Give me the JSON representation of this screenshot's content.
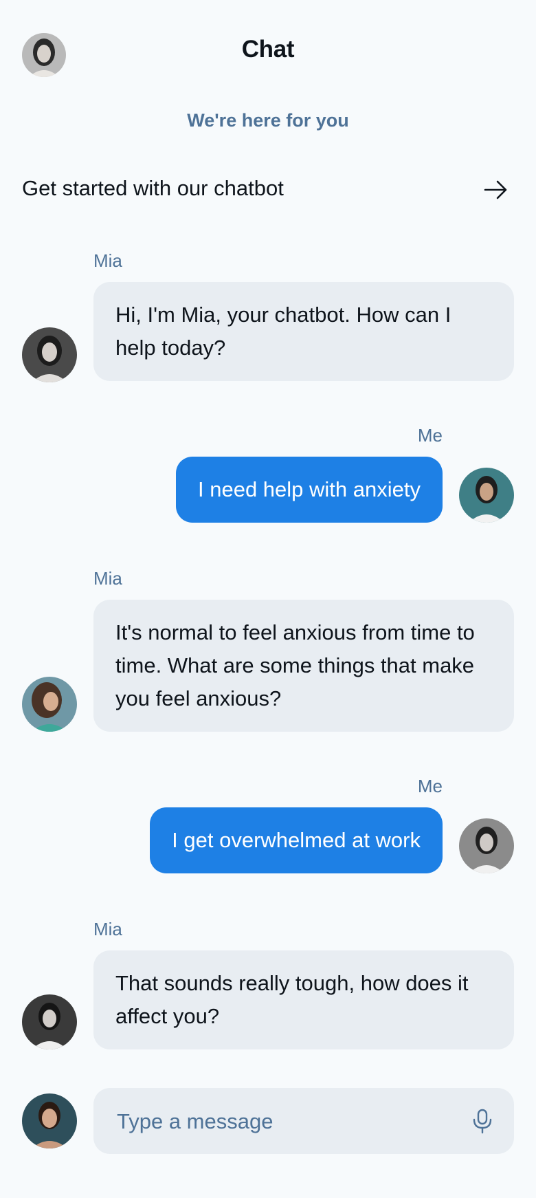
{
  "header": {
    "title": "Chat",
    "avatar_icon": "user-avatar-photo"
  },
  "subtitle": "We're here for you",
  "cta": {
    "label": "Get started with our chatbot",
    "icon": "arrow-right-icon"
  },
  "messages": [
    {
      "sender": "Mia",
      "from": "bot",
      "text": "Hi, I'm Mia, your chatbot. How can I help today?"
    },
    {
      "sender": "Me",
      "from": "me",
      "text": "I need help with anxiety"
    },
    {
      "sender": "Mia",
      "from": "bot",
      "text": "It's normal to feel anxious from time to time. What are some things that make you feel anxious?"
    },
    {
      "sender": "Me",
      "from": "me",
      "text": "I get overwhelmed at work"
    },
    {
      "sender": "Mia",
      "from": "bot",
      "text": "That sounds really tough, how does it affect you?"
    }
  ],
  "composer": {
    "placeholder": "Type a message",
    "mic_icon": "microphone-icon"
  },
  "colors": {
    "background": "#f7fafc",
    "accent": "#1e80e5",
    "bot_bubble": "#e8edf2",
    "muted_text": "#4e7297",
    "text": "#0e141b"
  }
}
